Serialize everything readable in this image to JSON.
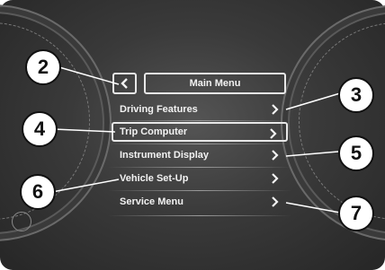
{
  "menu": {
    "title": "Main Menu",
    "items": [
      {
        "label": "Driving Features",
        "selected": false
      },
      {
        "label": "Trip Computer",
        "selected": true
      },
      {
        "label": "Instrument Display",
        "selected": false
      },
      {
        "label": "Vehicle Set-Up",
        "selected": false
      },
      {
        "label": "Service Menu",
        "selected": false
      }
    ]
  },
  "callouts": [
    "2",
    "3",
    "4",
    "5",
    "6",
    "7"
  ],
  "icons": {
    "back": "chevron-left-icon",
    "item_arrow": "chevron-right-icon"
  },
  "colors": {
    "background": "#3a3a3a",
    "text": "#f2f2f2",
    "callout_fill": "#ffffff",
    "callout_border": "#111111"
  }
}
